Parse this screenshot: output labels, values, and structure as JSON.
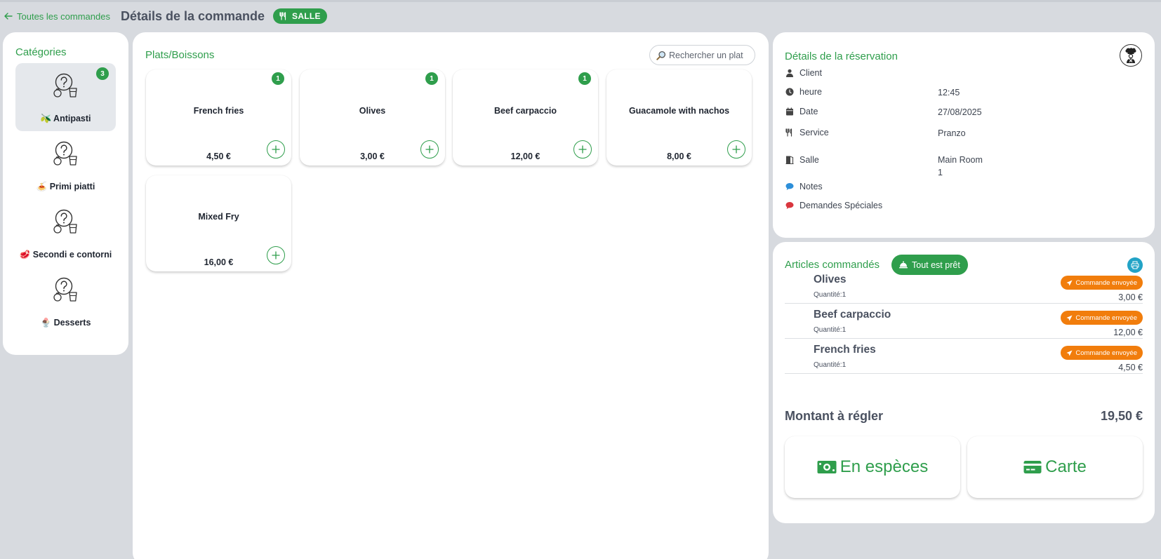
{
  "header": {
    "back_label": "Toutes les commandes",
    "title": "Détails de la commande",
    "badge": "SALLE"
  },
  "categories": {
    "title": "Catégories",
    "items": [
      {
        "label": "🫒 Antipasti",
        "count": "3",
        "active": true
      },
      {
        "label": "🍝 Primi piatti",
        "count": "",
        "active": false
      },
      {
        "label": "🥩 Secondi e contorni",
        "count": "",
        "active": false
      },
      {
        "label": "🍨 Desserts",
        "count": "",
        "active": false
      }
    ]
  },
  "dishes": {
    "title": "Plats/Boissons",
    "search_placeholder": "Rechercher un plat",
    "items": [
      {
        "name": "French fries",
        "price": "4,50 €",
        "count": "1"
      },
      {
        "name": "Olives",
        "price": "3,00 €",
        "count": "1"
      },
      {
        "name": "Beef carpaccio",
        "price": "12,00 €",
        "count": "1"
      },
      {
        "name": "Guacamole with nachos",
        "price": "8,00 €",
        "count": ""
      },
      {
        "name": "Mixed Fry",
        "price": "16,00 €",
        "count": ""
      }
    ]
  },
  "reservation": {
    "title": "Détails de la réservation",
    "client_label": "Client",
    "time_label": "heure",
    "time_value": "12:45",
    "date_label": "Date",
    "date_value": "27/08/2025",
    "service_label": "Service",
    "service_value": "Pranzo",
    "room_label": "Salle",
    "room_value": "Main Room",
    "table_value": "1",
    "notes_label": "Notes",
    "special_label": "Demandes Spéciales"
  },
  "order": {
    "title": "Articles commandés",
    "ready_label": "Tout est prêt",
    "items": [
      {
        "name": "Olives",
        "qty": "Quantité:1",
        "status": "Commande envoyée",
        "price": "3,00 €"
      },
      {
        "name": "Beef carpaccio",
        "qty": "Quantité:1",
        "status": "Commande envoyée",
        "price": "12,00 €"
      },
      {
        "name": "French fries",
        "qty": "Quantité:1",
        "status": "Commande envoyée",
        "price": "4,50 €"
      }
    ],
    "total_label": "Montant à régler",
    "total_value": "19,50 €",
    "cash_label": "En espèces",
    "card_label": "Carte"
  },
  "colors": {
    "accent": "#2f9e4c",
    "status_orange": "#f17d0c",
    "print_blue": "#22a3c6",
    "background": "#d7dadf"
  },
  "icons": {
    "back": "arrow-left-icon",
    "badge": "utensils-icon",
    "category": "unknown-dish-icon",
    "search": "magnifier-icon",
    "add": "plus-icon",
    "chef": "chef-icon",
    "ready": "cloche-icon",
    "print": "printer-icon",
    "status": "paper-plane-icon",
    "cash": "banknote-icon",
    "card": "credit-card-icon"
  }
}
